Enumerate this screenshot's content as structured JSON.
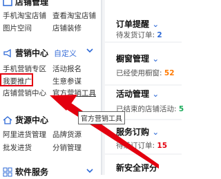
{
  "shop_mgmt": {
    "title": "店铺管理",
    "links": [
      "手机淘宝店铺",
      "查看淘宝店铺",
      "图片空间",
      "店铺装修"
    ]
  },
  "marketing": {
    "title": "营销中心",
    "custom": "自定义",
    "links": [
      "手机营销专区",
      "活动报名",
      "我要推广",
      "生意参谋",
      "店铺营销中心",
      "官方营销工具"
    ]
  },
  "sourcing": {
    "title": "货源中心",
    "links": [
      "阿里进货管理",
      "品牌货源",
      "批发进货",
      "分销管理"
    ]
  },
  "software": {
    "title": "软件服务"
  },
  "right_cards": [
    {
      "title": "订单提醒",
      "sub": "待发货订单:",
      "value": "2"
    },
    {
      "title": "橱窗管理",
      "sub": "已经使用橱窗:",
      "value": "52"
    },
    {
      "title": "活动管理",
      "sub": "已结束的店铺活动:",
      "value": "5"
    },
    {
      "title": "服务订购",
      "sub": "待续订订单:",
      "value": "15"
    },
    {
      "title": "新安全评分"
    }
  ],
  "tooltip": "官方营销工具",
  "colors": {
    "highlight": "#e3000f",
    "arrow": "#e3000f",
    "accent": "#2c68d6"
  }
}
